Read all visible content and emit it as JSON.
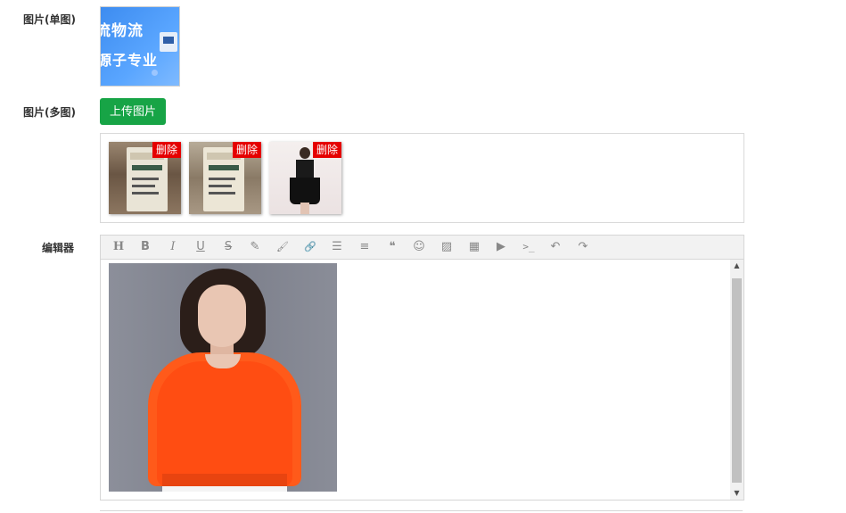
{
  "form": {
    "single_image_label": "图片(单图)",
    "multi_image_label": "图片(多图)",
    "editor_label": "编辑器",
    "upload_button_label": "上传图片"
  },
  "single_image": {
    "text_line1": "流物流",
    "text_line2": "源子专业",
    "accent": "#3d8cf0"
  },
  "multi_images": [
    {
      "delete_label": "删除",
      "subject": "milk-carton-1"
    },
    {
      "delete_label": "删除",
      "subject": "milk-carton-2"
    },
    {
      "delete_label": "删除",
      "subject": "black-dress"
    }
  ],
  "editor": {
    "toolbar": [
      {
        "name": "heading-icon",
        "glyph": "H"
      },
      {
        "name": "bold-icon",
        "glyph": "B"
      },
      {
        "name": "italic-icon",
        "glyph": "I"
      },
      {
        "name": "underline-icon",
        "glyph": "U"
      },
      {
        "name": "strikethrough-icon",
        "glyph": "S"
      },
      {
        "name": "font-color-icon",
        "glyph": "✎"
      },
      {
        "name": "background-color-icon",
        "glyph": "🖌"
      },
      {
        "name": "link-icon",
        "glyph": "🔗"
      },
      {
        "name": "list-icon",
        "glyph": "☰"
      },
      {
        "name": "align-icon",
        "glyph": "≡"
      },
      {
        "name": "quote-icon",
        "glyph": "❝"
      },
      {
        "name": "emoticon-icon",
        "glyph": "☺"
      },
      {
        "name": "image-icon",
        "glyph": "▨"
      },
      {
        "name": "table-icon",
        "glyph": "▦"
      },
      {
        "name": "video-icon",
        "glyph": "▶"
      },
      {
        "name": "code-icon",
        "glyph": ">_"
      },
      {
        "name": "undo-icon",
        "glyph": "↶"
      },
      {
        "name": "redo-icon",
        "glyph": "↷"
      }
    ],
    "content_image": "woman-orange-blouse"
  },
  "colors": {
    "upload_button": "#17a446",
    "delete_badge": "#e50000"
  }
}
